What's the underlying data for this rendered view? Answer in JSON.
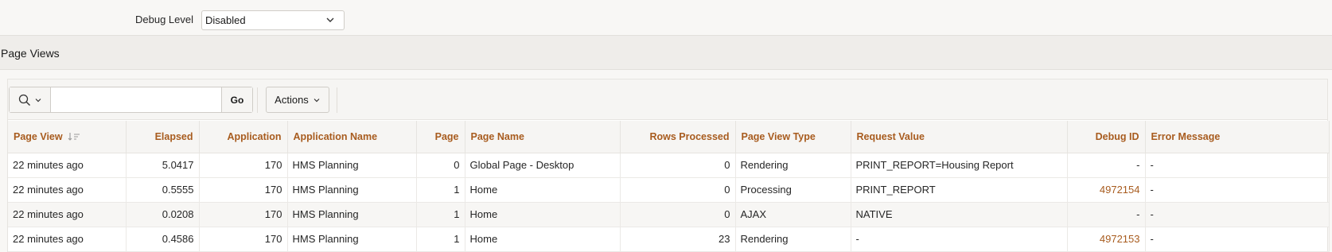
{
  "filter": {
    "debug_label": "Debug Level",
    "debug_value": "Disabled"
  },
  "region": {
    "title": "Page Views"
  },
  "toolbar": {
    "search_value": "",
    "go_label": "Go",
    "actions_label": "Actions"
  },
  "columns": [
    "Page View",
    "Elapsed",
    "Application",
    "Application Name",
    "Page",
    "Page Name",
    "Rows Processed",
    "Page View Type",
    "Request Value",
    "Debug ID",
    "Error Message"
  ],
  "rows": [
    [
      "22 minutes ago",
      "5.0417",
      "170",
      "HMS Planning",
      "0",
      "Global Page - Desktop",
      "0",
      "Rendering",
      "PRINT_REPORT=Housing Report",
      "-",
      "-"
    ],
    [
      "22 minutes ago",
      "0.5555",
      "170",
      "HMS Planning",
      "1",
      "Home",
      "0",
      "Processing",
      "PRINT_REPORT",
      "4972154",
      "-"
    ],
    [
      "22 minutes ago",
      "0.0208",
      "170",
      "HMS Planning",
      "1",
      "Home",
      "0",
      "AJAX",
      "NATIVE",
      "-",
      "-"
    ],
    [
      "22 minutes ago",
      "0.4586",
      "170",
      "HMS Planning",
      "1",
      "Home",
      "23",
      "Rendering",
      "-",
      "4972153",
      "-"
    ]
  ],
  "colors": {
    "header_text": "#a85c1f",
    "link_text": "#a85c1f"
  }
}
